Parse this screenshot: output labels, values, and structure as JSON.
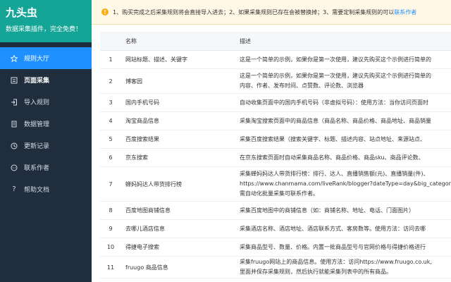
{
  "brand": {
    "title": "九头虫",
    "subtitle": "数据采集插件，完全免费！"
  },
  "menu": [
    {
      "label": "规则大厅",
      "icon": "star-icon"
    },
    {
      "label": "页面采集",
      "icon": "page-collect-icon"
    },
    {
      "label": "导入规则",
      "icon": "import-icon"
    },
    {
      "label": "数据管理",
      "icon": "data-icon"
    },
    {
      "label": "更新记录",
      "icon": "history-icon"
    },
    {
      "label": "联系作者",
      "icon": "chat-icon"
    },
    {
      "label": "帮助文档",
      "icon": "help-icon"
    }
  ],
  "notice": {
    "text": "1、购买完成之后采集规则将会直接导入进去；2、如果采集规则已存在会被替换掉；3、需要定制采集规则的可以",
    "link": "联系作者"
  },
  "table": {
    "headers": {
      "name": "名称",
      "desc": "描述"
    },
    "rows": [
      {
        "index": "1",
        "name": "网站标题、描述、关键字",
        "desc": [
          "这是一个简单的示例，如果你是第一次使用，建议先购买这个示例进行简单的"
        ]
      },
      {
        "index": "2",
        "name": "博客园",
        "desc": [
          "这是一个简单的示例，如果你是第一次使用，建议先购买这个示例进行简单的",
          "内容、作者、发布时间、点赞数、评论数、浏览器"
        ]
      },
      {
        "index": "3",
        "name": "国内手机号码",
        "desc": [
          "自动收集页面中的国内手机号码（非虚拟号码）：使用方法：当你访问页面时"
        ]
      },
      {
        "index": "4",
        "name": "淘宝商品信息",
        "desc": [
          "采集淘宝搜索页面中的商品信息（商品名称、商品价格、商品地址、商品销量"
        ]
      },
      {
        "index": "5",
        "name": "百度搜索结果",
        "desc": [
          "采集百度搜索结果（搜索关键字、标题、描述内容、站点地址、来源站点、"
        ]
      },
      {
        "index": "6",
        "name": "京东搜索",
        "desc": [
          "在京东搜索页面时自动采集商品名称、商品价格、商品sku、商品评论数、"
        ]
      },
      {
        "index": "7",
        "name": "蝉妈妈达人带货排行榜",
        "desc": [
          "采集蝉妈妈达人带货排行榜：排行、达人、直播销售额(元)、直播销量(件)、",
          "https://www.chanmama.com/liveRank/blogger?dateType=day&big_category",
          "需自动化批量采集可联系作者。"
        ]
      },
      {
        "index": "8",
        "name": "百度地图商铺信息",
        "desc": [
          "采集百度地图中的商铺信息（如：商铺名称、地址、电话、门面图片）"
        ]
      },
      {
        "index": "9",
        "name": "去哪儿酒店信息",
        "desc": [
          "采集酒店名称、酒店地址、酒店联系方式、客房数等。使用方法：访问去哪"
        ]
      },
      {
        "index": "10",
        "name": "得捷电子搜索",
        "desc": [
          "采集商品型号、数量、价格。内置一批商品型号与官网价格与得捷价格进行"
        ]
      },
      {
        "index": "11",
        "name": "fruugo 商品信息",
        "desc": [
          "采集fruugo网站上的商品信息。使用方法：访问https://www.fruugo.co.uk,",
          "里面并保存采集规则，然后执行就能采集列表中的所有商品。"
        ]
      }
    ]
  }
}
